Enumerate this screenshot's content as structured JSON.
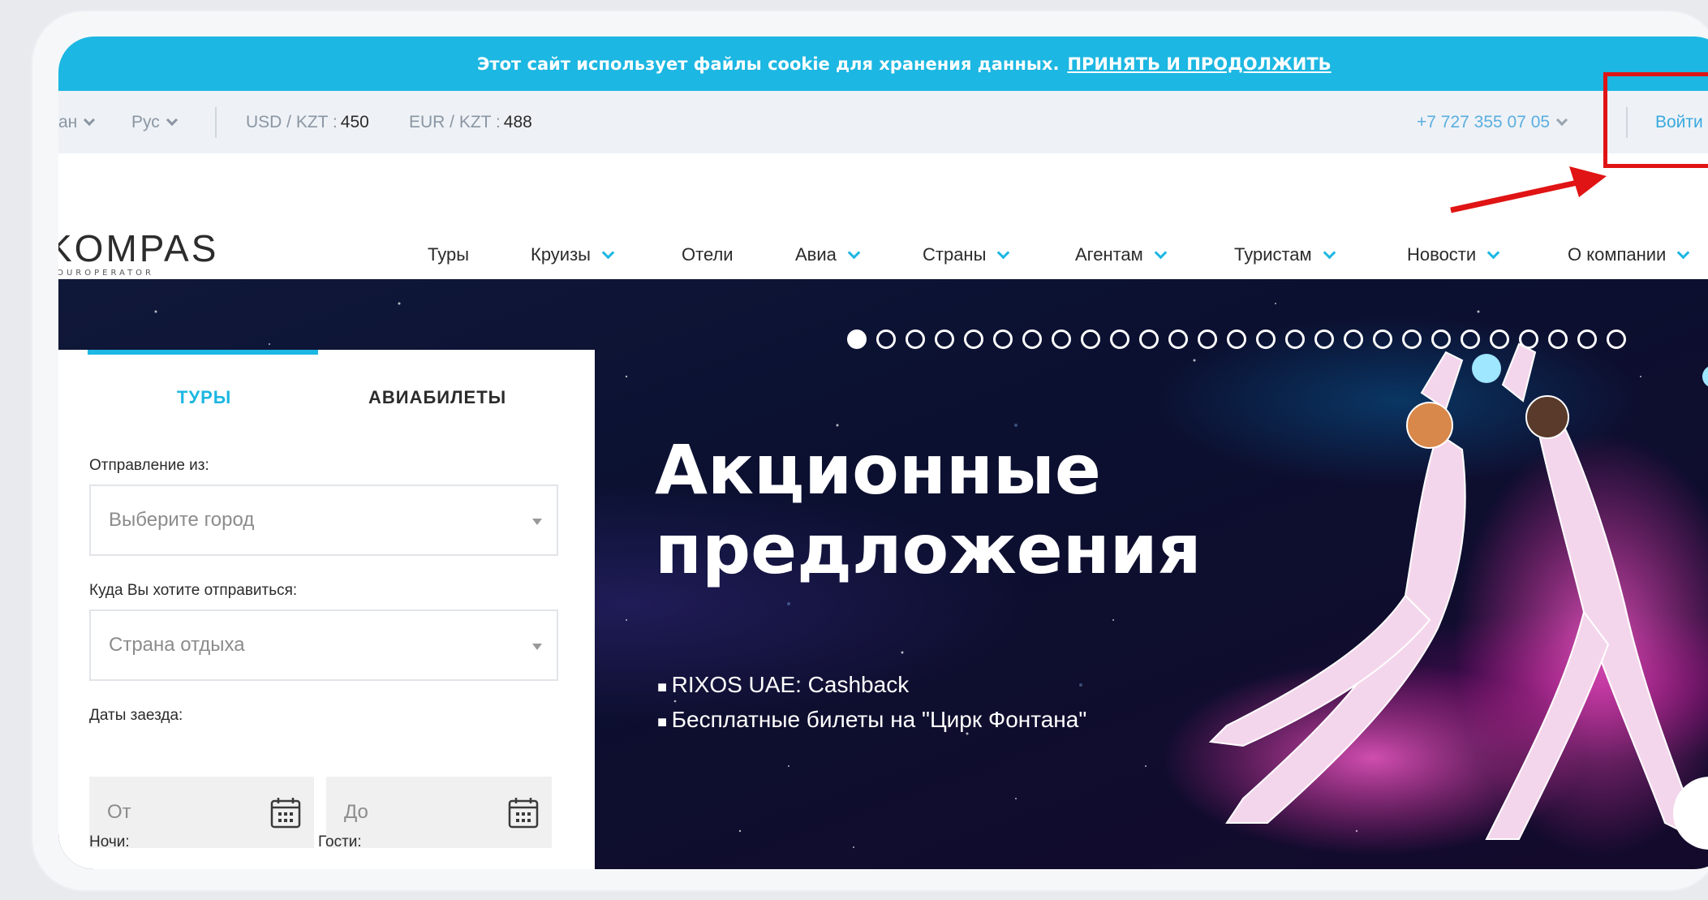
{
  "cookie": {
    "text": "Этот сайт использует файлы cookie для хранения данных.",
    "link": "ПРИНЯТЬ И ПРОДОЛЖИТЬ"
  },
  "utilbar": {
    "region": "ан",
    "language": "Рус",
    "usd_label": "USD / KZT :",
    "usd_value": "450",
    "eur_label": "EUR / KZT :",
    "eur_value": "488",
    "phone": "+7 727 355 07 05",
    "login": "Войти"
  },
  "logo": {
    "main": "KOMPAS",
    "sub": "TOUROPERATOR"
  },
  "nav": {
    "items": [
      {
        "label": "Туры",
        "dropdown": false
      },
      {
        "label": "Круизы",
        "dropdown": true
      },
      {
        "label": "Отели",
        "dropdown": false
      },
      {
        "label": "Авиа",
        "dropdown": true
      },
      {
        "label": "Страны",
        "dropdown": true
      },
      {
        "label": "Агентам",
        "dropdown": true
      },
      {
        "label": "Туристам",
        "dropdown": true
      },
      {
        "label": "Новости",
        "dropdown": true
      },
      {
        "label": "О компании",
        "dropdown": true
      }
    ]
  },
  "hero": {
    "title_line1": "Акционные",
    "title_line2": "предложения",
    "bullets": [
      "RIXOS UAE: Cashback",
      "Бесплатные билеты на \"Цирк Фонтана\""
    ],
    "slide_count": 27,
    "active_slide": 1
  },
  "search": {
    "tab_tours": "ТУРЫ",
    "tab_avia": "АВИАБИЛЕТЫ",
    "from_label": "Отправление из:",
    "from_placeholder": "Выберите город",
    "to_label": "Куда Вы хотите отправиться:",
    "to_placeholder": "Страна отдыха",
    "dates_label": "Даты заезда:",
    "date_from": "От",
    "date_to": "До",
    "nights_label": "Ночи:",
    "guests_label": "Гости:"
  },
  "colors": {
    "accent": "#1cb7e2",
    "annotation": "#e01414"
  }
}
